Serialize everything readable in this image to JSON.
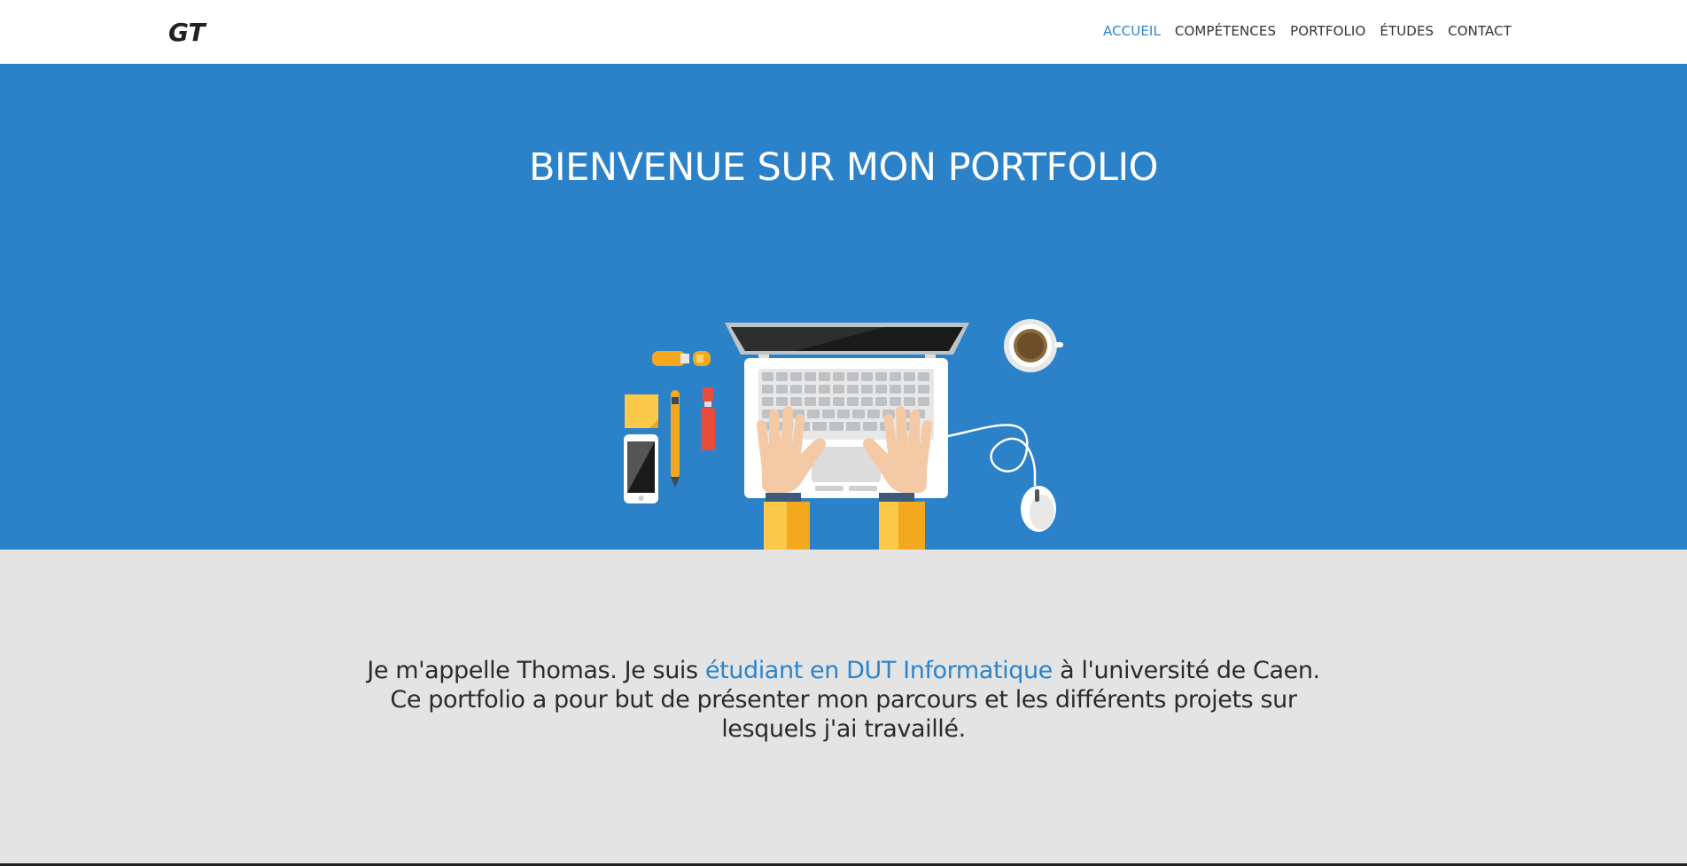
{
  "navbar": {
    "logo_text": "GT",
    "links": [
      {
        "label": "ACCUEIL",
        "active": true
      },
      {
        "label": "COMPÉTENCES",
        "active": false
      },
      {
        "label": "PORTFOLIO",
        "active": false
      },
      {
        "label": "ÉTUDES",
        "active": false
      },
      {
        "label": "CONTACT",
        "active": false
      }
    ]
  },
  "hero": {
    "title": "BIENVENUE SUR MON PORTFOLIO",
    "background_color": "#2c82c9"
  },
  "about": {
    "text_before": "Je m'appelle Thomas. Je suis ",
    "highlight": "étudiant en DUT Informatique",
    "text_after": " à l'université de Caen. Ce portfolio a pour but de présenter mon parcours et les différents projets sur lesquels j'ai travaillé.",
    "accent_color": "#2c84cc"
  }
}
